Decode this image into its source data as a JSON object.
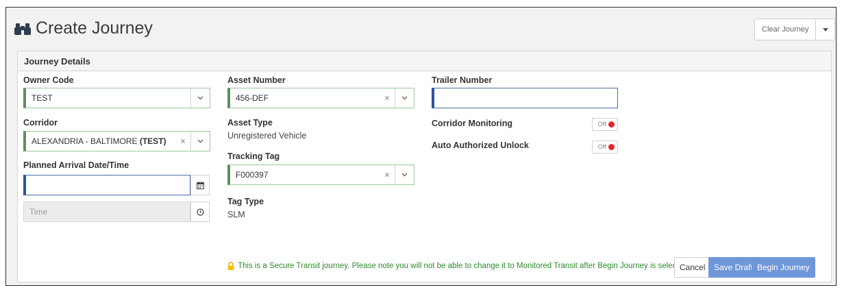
{
  "header": {
    "title": "Create Journey",
    "title_icon": "binoculars-icon"
  },
  "actions": {
    "clear_label": "Clear Journey"
  },
  "panel": {
    "title": "Journey Details"
  },
  "owner_code": {
    "label": "Owner Code",
    "value": "TEST"
  },
  "corridor": {
    "label": "Corridor",
    "value_main": "ALEXANDRIA - BALTIMORE",
    "value_code": "(TEST)"
  },
  "planned_arrival": {
    "label": "Planned Arrival Date/Time",
    "date_value": "",
    "time_placeholder": "Time"
  },
  "asset_number": {
    "label": "Asset Number",
    "value": "456-DEF"
  },
  "asset_type": {
    "label": "Asset Type",
    "value": "Unregistered Vehicle"
  },
  "tracking_tag": {
    "label": "Tracking Tag",
    "value": "F000397"
  },
  "tag_type": {
    "label": "Tag Type",
    "value": "SLM"
  },
  "trailer_number": {
    "label": "Trailer Number",
    "value": ""
  },
  "corridor_monitoring": {
    "label": "Corridor Monitoring",
    "state": "Off"
  },
  "auto_unlock": {
    "label": "Auto Authorized Unlock",
    "state": "Off"
  },
  "footer": {
    "notice": "This is a Secure Transit journey. Please note you will not be able to change it to Monitored Transit after Begin Journey is selected.",
    "cancel_label": "Cancel",
    "save_label": "Save Draft",
    "begin_label": "Begin Journey"
  },
  "colors": {
    "accent": "#6f97d8",
    "success_border": "#5e8f5e",
    "focus_border": "#2f5597",
    "toggle_off": "#e8262d",
    "notice": "#2e8b2e"
  }
}
